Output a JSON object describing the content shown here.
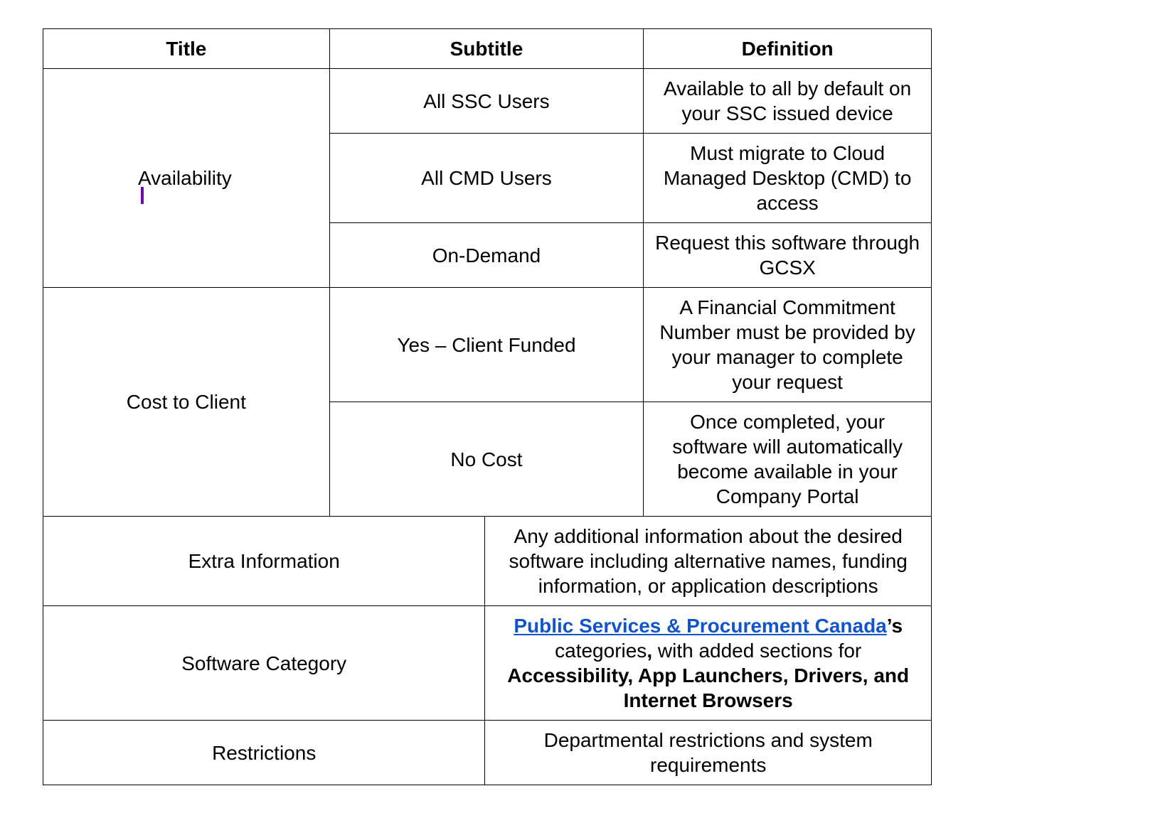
{
  "headers": {
    "title": "Title",
    "subtitle": "Subtitle",
    "definition": "Definition"
  },
  "rows": {
    "availability": {
      "title": "Availability",
      "items": [
        {
          "subtitle": "All SSC Users",
          "definition": "Available to all by default on your SSC issued device"
        },
        {
          "subtitle": "All CMD Users",
          "definition": "Must migrate to Cloud Managed Desktop (CMD) to access"
        },
        {
          "subtitle": "On-Demand",
          "definition": "Request this software through GCSX"
        }
      ]
    },
    "cost": {
      "title": "Cost to Client",
      "items": [
        {
          "subtitle": "Yes – Client Funded",
          "definition": "A Financial Commitment Number must be provided by your manager to complete your request"
        },
        {
          "subtitle": "No Cost",
          "definition": "Once completed, your software will automatically become available in your Company Portal"
        }
      ]
    },
    "extra": {
      "title": "Extra Information",
      "definition": "Any additional information about the desired software including alternative names, funding information, or application descriptions"
    },
    "category": {
      "title": "Software Category",
      "link_text": "Public Services & Procurement Canada",
      "possessive": "’s",
      "mid1": " categories",
      "comma": ",",
      "mid2": " with added sections for ",
      "extra_bold": "Accessibility, App Launchers, Drivers, and Internet Browsers"
    },
    "restrictions": {
      "title": "Restrictions",
      "definition": "Departmental restrictions and system requirements"
    }
  }
}
